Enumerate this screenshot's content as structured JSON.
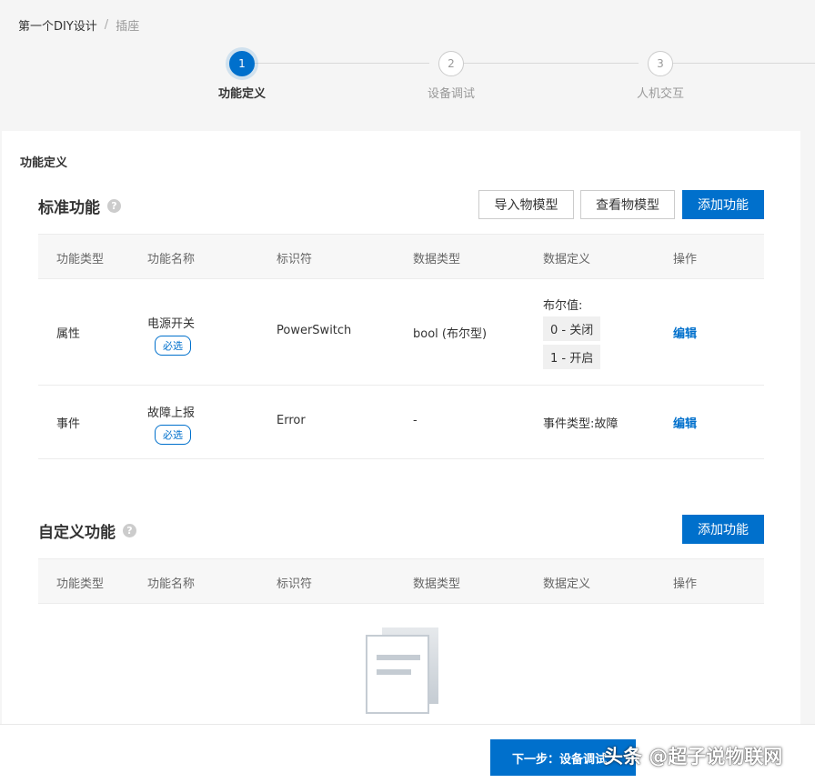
{
  "breadcrumb": {
    "root": "第一个DIY设计",
    "separator": "/",
    "current": "插座"
  },
  "steps": [
    {
      "num": "1",
      "label": "功能定义",
      "active": true
    },
    {
      "num": "2",
      "label": "设备调试",
      "active": false
    },
    {
      "num": "3",
      "label": "人机交互",
      "active": false
    }
  ],
  "card_title": "功能定义",
  "standard": {
    "title": "标准功能",
    "help": "?",
    "buttons": {
      "import": "导入物模型",
      "view": "查看物模型",
      "add": "添加功能"
    },
    "columns": [
      "功能类型",
      "功能名称",
      "标识符",
      "数据类型",
      "数据定义",
      "操作"
    ],
    "rows": [
      {
        "type": "属性",
        "name": "电源开关",
        "badge": "必选",
        "identifier": "PowerSwitch",
        "data_type": "bool (布尔型)",
        "def_title": "布尔值:",
        "def_items": [
          "0 - 关闭",
          "1 - 开启"
        ],
        "action": "编辑"
      },
      {
        "type": "事件",
        "name": "故障上报",
        "badge": "必选",
        "identifier": "Error",
        "data_type": "-",
        "def_text": "事件类型:故障",
        "action": "编辑"
      }
    ]
  },
  "custom": {
    "title": "自定义功能",
    "help": "?",
    "add": "添加功能",
    "columns": [
      "功能类型",
      "功能名称",
      "标识符",
      "数据类型",
      "数据定义",
      "操作"
    ]
  },
  "footer": {
    "next": "下一步：设备调试"
  },
  "watermark": "头条 @超子说物联网",
  "colors": {
    "primary": "#0070cc",
    "background": "#f5f5f5"
  },
  "icons": {
    "help": "question-circle-icon",
    "empty": "empty-document-icon"
  }
}
